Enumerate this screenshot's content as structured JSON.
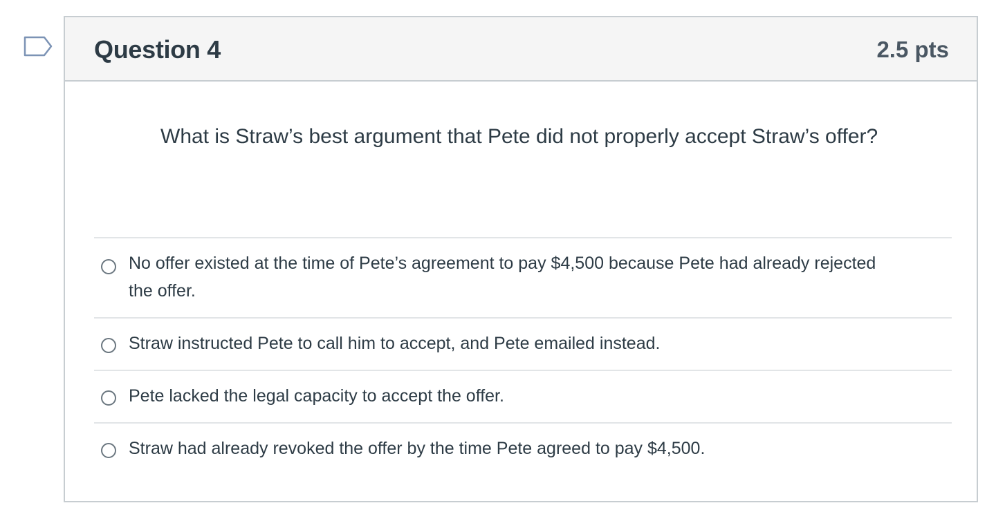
{
  "question": {
    "title": "Question 4",
    "points": "2.5 pts",
    "text": "What is Straw’s best argument that Pete did not properly accept Straw’s offer?",
    "flag_icon": "flag-bookmark-icon",
    "colors": {
      "header_bg": "#f5f5f5",
      "border": "#c7cdd1",
      "flag": "#7c93b5",
      "text": "#2d3b45"
    }
  },
  "answers": [
    {
      "label": "No offer existed at the time of Pete’s agreement to pay $4,500 because Pete had already rejected the offer.",
      "selected": false
    },
    {
      "label": "Straw instructed Pete to call him to accept, and Pete emailed instead.",
      "selected": false
    },
    {
      "label": "Pete lacked the legal capacity to accept the offer.",
      "selected": false
    },
    {
      "label": "Straw had already revoked the offer by the time Pete agreed to pay $4,500.",
      "selected": false
    }
  ]
}
